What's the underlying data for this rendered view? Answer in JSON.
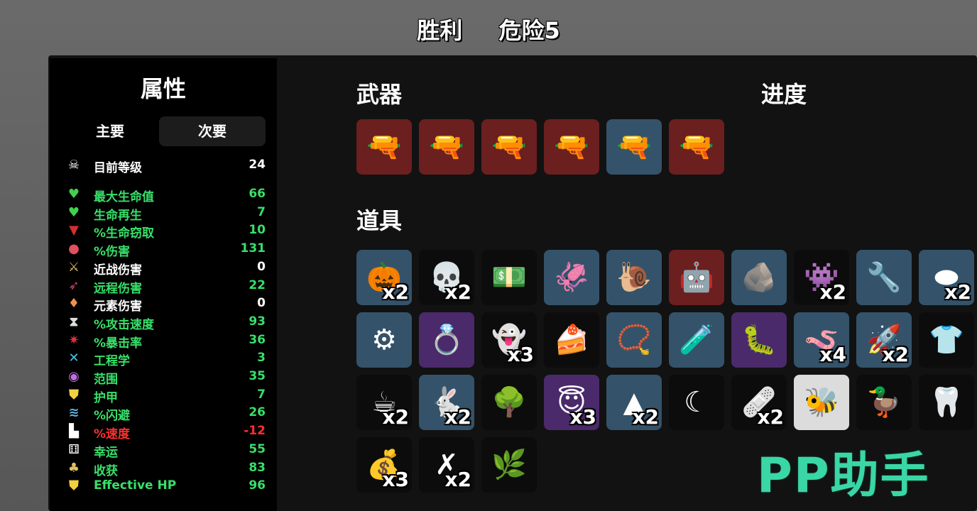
{
  "header": {
    "result": "胜利",
    "danger": "危险5"
  },
  "stats": {
    "title": "属性",
    "tabs": {
      "primary": "主要",
      "secondary": "次要"
    },
    "level": {
      "label": "目前等级",
      "value": "24",
      "icon": "level-skull-icon"
    },
    "rows": [
      {
        "label": "最大生命值",
        "value": "66",
        "color": "green",
        "icon": "heart-icon"
      },
      {
        "label": "生命再生",
        "value": "7",
        "color": "green",
        "icon": "heart-plus-icon"
      },
      {
        "label": "%生命窃取",
        "value": "10",
        "color": "green",
        "icon": "fangs-icon"
      },
      {
        "label": "%伤害",
        "value": "131",
        "color": "green",
        "icon": "muscle-icon"
      },
      {
        "label": "近战伤害",
        "value": "0",
        "color": "white",
        "icon": "sword-icon"
      },
      {
        "label": "远程伤害",
        "value": "22",
        "color": "green",
        "icon": "bow-icon"
      },
      {
        "label": "元素伤害",
        "value": "0",
        "color": "white",
        "icon": "flame-icon"
      },
      {
        "label": "%攻击速度",
        "value": "93",
        "color": "green",
        "icon": "hourglass-icon"
      },
      {
        "label": "%暴击率",
        "value": "36",
        "color": "green",
        "icon": "crit-icon"
      },
      {
        "label": "工程学",
        "value": "3",
        "color": "green",
        "icon": "wrench-icon"
      },
      {
        "label": "范围",
        "value": "35",
        "color": "green",
        "icon": "range-icon"
      },
      {
        "label": "护甲",
        "value": "7",
        "color": "green",
        "icon": "shield-icon"
      },
      {
        "label": "%闪避",
        "value": "26",
        "color": "green",
        "icon": "dodge-icon"
      },
      {
        "label": "%速度",
        "value": "-12",
        "color": "red",
        "icon": "boot-icon"
      },
      {
        "label": "幸运",
        "value": "55",
        "color": "green",
        "icon": "dice-icon"
      },
      {
        "label": "收获",
        "value": "83",
        "color": "green",
        "icon": "wheat-icon"
      },
      {
        "label": "Effective HP",
        "value": "96",
        "color": "green",
        "icon": "hp-shield-icon"
      }
    ]
  },
  "weapons": {
    "title": "武器",
    "items": [
      {
        "name": "double-barrel-shotgun-icon",
        "tier": "red",
        "glyph": "🔫"
      },
      {
        "name": "turret-gun-icon",
        "tier": "red",
        "glyph": "🔫"
      },
      {
        "name": "turret-gun-icon",
        "tier": "red",
        "glyph": "🔫"
      },
      {
        "name": "turret-gun-icon",
        "tier": "red",
        "glyph": "🔫"
      },
      {
        "name": "turret-gun-icon",
        "tier": "blue",
        "glyph": "🔫"
      },
      {
        "name": "double-barrel-shotgun-icon",
        "tier": "red",
        "glyph": "🔫"
      }
    ]
  },
  "progress": {
    "title": "进度"
  },
  "items": {
    "title": "道具",
    "rows": [
      [
        {
          "name": "pumpkin-icon",
          "tier": "blue",
          "glyph": "🎃",
          "count": "x2"
        },
        {
          "name": "skull-icon",
          "tier": "dark",
          "glyph": "💀",
          "count": "x2"
        },
        {
          "name": "banknote-icon",
          "tier": "dark",
          "glyph": "💵",
          "count": ""
        },
        {
          "name": "tentacle-icon",
          "tier": "blue",
          "glyph": "🦑",
          "count": ""
        },
        {
          "name": "snail-icon",
          "tier": "blue",
          "glyph": "🐌",
          "count": ""
        },
        {
          "name": "robot-frame-icon",
          "tier": "red",
          "glyph": "🤖",
          "count": ""
        },
        {
          "name": "stone-icon",
          "tier": "blue",
          "glyph": "🪨",
          "count": ""
        },
        {
          "name": "alien-creature-icon",
          "tier": "dark",
          "glyph": "👾",
          "count": "x2"
        },
        {
          "name": "wrench-tool-icon",
          "tier": "blue",
          "glyph": "🔧",
          "count": ""
        },
        {
          "name": "black-blob-icon",
          "tier": "blue",
          "glyph": "⬬",
          "count": "x2"
        }
      ],
      [
        {
          "name": "machine-icon",
          "tier": "blue",
          "glyph": "⚙",
          "count": ""
        },
        {
          "name": "ring-icon",
          "tier": "purple",
          "glyph": "💍",
          "count": ""
        },
        {
          "name": "ghost-icon",
          "tier": "dark",
          "glyph": "👻",
          "count": "x3"
        },
        {
          "name": "cake-icon",
          "tier": "dark",
          "glyph": "🍰",
          "count": ""
        },
        {
          "name": "necklace-icon",
          "tier": "blue",
          "glyph": "📿",
          "count": ""
        },
        {
          "name": "potion-icon",
          "tier": "blue",
          "glyph": "🧪",
          "count": ""
        },
        {
          "name": "tardigrade-icon",
          "tier": "purple",
          "glyph": "🐛",
          "count": ""
        },
        {
          "name": "worm-icon",
          "tier": "blue",
          "glyph": "🪱",
          "count": "x4"
        },
        {
          "name": "cannon-icon",
          "tier": "blue",
          "glyph": "🚀",
          "count": "x2"
        },
        {
          "name": "plaid-shirt-icon",
          "tier": "dark",
          "glyph": "👕",
          "count": ""
        }
      ],
      [
        {
          "name": "coffee-cup-icon",
          "tier": "dark",
          "glyph": "☕",
          "count": "x2"
        },
        {
          "name": "bunny-icon",
          "tier": "blue",
          "glyph": "🐇",
          "count": "x2"
        },
        {
          "name": "tree-icon",
          "tier": "dark",
          "glyph": "🌳",
          "count": ""
        },
        {
          "name": "angel-orb-icon",
          "tier": "purple",
          "glyph": "😇",
          "count": "x3"
        },
        {
          "name": "bullet-icon",
          "tier": "blue",
          "glyph": "▲",
          "count": "x2"
        },
        {
          "name": "scythe-icon",
          "tier": "dark",
          "glyph": "☾",
          "count": ""
        },
        {
          "name": "bandage-icon",
          "tier": "dark",
          "glyph": "🩹",
          "count": "x2"
        },
        {
          "name": "bee-icon",
          "tier": "white",
          "glyph": "🐝",
          "count": ""
        },
        {
          "name": "rubber-duck-icon",
          "tier": "dark",
          "glyph": "🦆",
          "count": ""
        },
        {
          "name": "tooth-icon",
          "tier": "dark",
          "glyph": "🦷",
          "count": ""
        }
      ],
      [
        {
          "name": "sack-icon",
          "tier": "dark",
          "glyph": "💰",
          "count": "x3"
        },
        {
          "name": "red-spear-icon",
          "tier": "dark",
          "glyph": "✗",
          "count": "x2"
        },
        {
          "name": "herb-bag-icon",
          "tier": "dark",
          "glyph": "🌿",
          "count": ""
        }
      ]
    ]
  },
  "watermark": "PP助手",
  "colors": {
    "green": "#38e06a",
    "red": "#ff3030",
    "tier_red": "#6b1f1f",
    "tier_blue": "#34536a",
    "tier_purple": "#4a2a6a"
  }
}
